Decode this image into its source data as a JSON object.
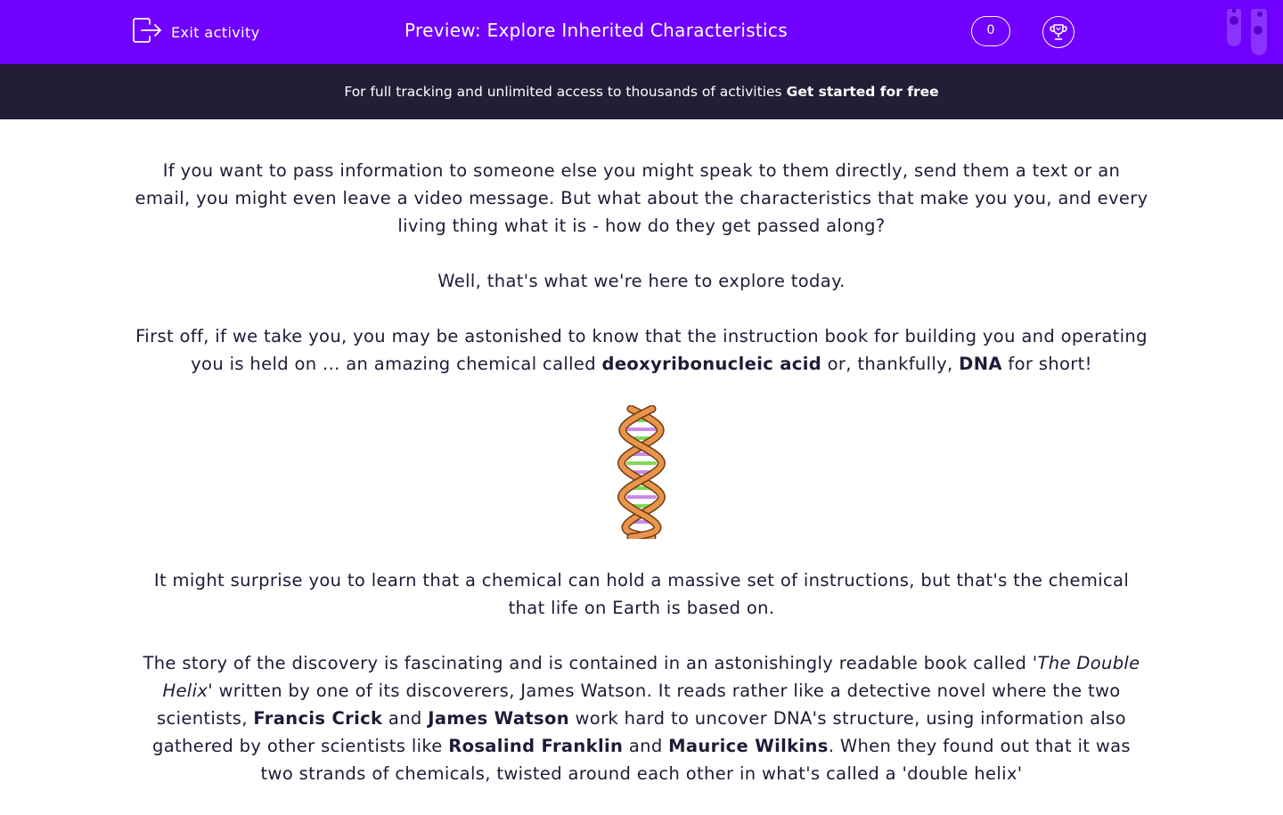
{
  "header": {
    "exit_label": "Exit activity",
    "title": "Preview: Explore Inherited Characteristics",
    "score": "0"
  },
  "promo": {
    "text": "For full tracking and unlimited access to thousands of activities",
    "cta": "Get started for free"
  },
  "content": {
    "p1": "If you want to pass information to someone else you might speak to them directly, send them a text or an email, you might even leave a video message. But what about the characteristics that make you you, and every living thing what it is - how do they get passed along?",
    "p2": "Well, that's what we're here to explore today.",
    "p3": {
      "a": "First off, if we take you, you may be astonished to know that the instruction book for building you and operating you is held on ... an amazing chemical called ",
      "b1": "deoxyribonucleic acid",
      "c": " or, thankfully, ",
      "b2": "DNA",
      "d": " for short!"
    },
    "p4": "It might surprise you to learn that a chemical can hold a massive set of instructions, but that's the chemical that life on Earth is based on.",
    "p5": {
      "a": "The story of the discovery is fascinating and is contained in an astonishingly readable book called '",
      "i1": "The Double Helix",
      "b": "' written by one of its discoverers, James Watson. It reads rather like a detective novel where the two scientists, ",
      "b1": "Francis Crick",
      "c": " and ",
      "b2": "James Watson",
      "d": " work hard to uncover DNA's structure, using information also gathered by other scientists like ",
      "b3": "Rosalind Franklin",
      "e": " and ",
      "b4": "Maurice Wilkins",
      "f": ". When they found out that it was two strands of chemicals, twisted around each other in what's called a 'double helix'"
    }
  },
  "icons": {
    "exit": "exit-icon",
    "trophy": "trophy-icon",
    "tubes": "test-tubes-icon",
    "dna": "dna-helix-icon"
  },
  "colors": {
    "header_bg": "#7000ff",
    "promo_bg": "#231d36",
    "text": "#1f1a37"
  }
}
